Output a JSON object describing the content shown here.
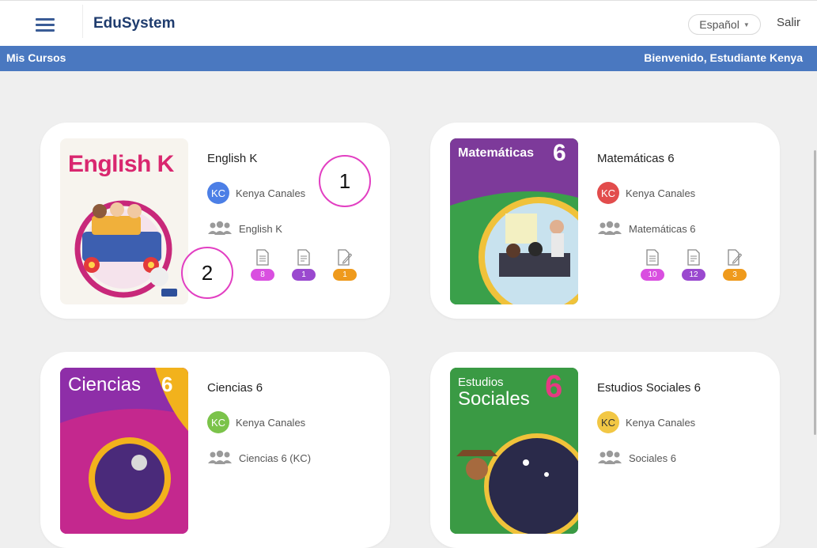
{
  "app": {
    "brand": "EduSystem",
    "language": "Español",
    "logout": "Salir"
  },
  "navbar": {
    "section": "Mis Cursos",
    "welcome": "Bienvenido, Estudiante Kenya"
  },
  "colors": {
    "nav": "#4a78c0",
    "badge_docs": "#d94fe0",
    "badge_lists": "#9a49cf",
    "badge_tasks": "#ef9a1c"
  },
  "courses": [
    {
      "title": "English K",
      "teacher": "Kenya Canales",
      "initials": "KC",
      "avatar_color": "#4c7fe6",
      "group": "English K",
      "cover_title": "English K",
      "stats": [
        "8",
        "1",
        "1"
      ]
    },
    {
      "title": "Matemáticas 6",
      "teacher": "Kenya Canales",
      "initials": "KC",
      "avatar_color": "#e24c4c",
      "group": "Matemáticas 6",
      "cover_title": "Matemáticas",
      "cover_number": "6",
      "stats": [
        "10",
        "12",
        "3"
      ]
    },
    {
      "title": "Ciencias 6",
      "teacher": "Kenya Canales",
      "initials": "KC",
      "avatar_color": "#7bc34a",
      "group": "Ciencias 6 (KC)",
      "cover_title": "Ciencias",
      "cover_number": "6"
    },
    {
      "title": "Estudios Sociales 6",
      "teacher": "Kenya Canales",
      "initials": "KC",
      "avatar_color": "#f2c744",
      "avatar_text_color": "#333333",
      "group": "Sociales 6",
      "cover_title": "Estudios",
      "cover_subtitle": "Sociales",
      "cover_number": "6"
    }
  ],
  "annotations": [
    "1",
    "2"
  ]
}
